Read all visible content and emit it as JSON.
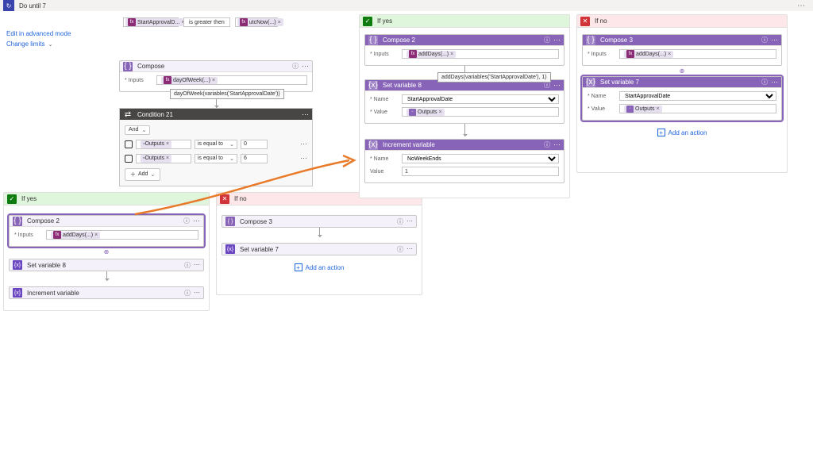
{
  "topbar": {
    "title": "Do until 7"
  },
  "links": {
    "advanced": "Edit in advanced mode",
    "limits": "Change limits"
  },
  "tokenrow": {
    "tok1": "StartApprovalD...",
    "op": "is greater then",
    "tok2": "utcNow(...)"
  },
  "compose": {
    "title": "Compose",
    "inputs_label": "* Inputs",
    "token": "dayOfWeek(...)",
    "tooltip": "dayOfWeek(variables('StartApprovalDate'))"
  },
  "cond": {
    "title": "Condition 21",
    "and": "And",
    "rows": [
      {
        "left": "Outputs",
        "op": "is equal to",
        "val": "0"
      },
      {
        "left": "Outputs",
        "op": "is equal to",
        "val": "6"
      }
    ],
    "add": "Add"
  },
  "branchLeft": {
    "yes": "If yes",
    "no": "If no",
    "compose2": "Compose 2",
    "compose3": "Compose 3",
    "setvar8": "Set variable 8",
    "setvar7": "Set variable 7",
    "incr": "Increment variable",
    "inputs_label": "* Inputs",
    "addDays": "addDays(...)",
    "addaction": "Add an action"
  },
  "right": {
    "yes": "If yes",
    "no": "If no",
    "compose2": {
      "title": "Compose 2",
      "inputs_label": "* Inputs",
      "token": "addDays(...)",
      "tooltip": "addDays(variables('StartApprovalDate'), 1)"
    },
    "compose3": {
      "title": "Compose 3",
      "inputs_label": "* Inputs",
      "token": "addDays(...)"
    },
    "setvar8": {
      "title": "Set variable 8",
      "name_label": "* Name",
      "name_val": "StartApprovalDate",
      "value_label": "* Value",
      "outputs": "Outputs"
    },
    "setvar7": {
      "title": "Set variable 7",
      "name_label": "* Name",
      "name_val": "StartApprovalDate",
      "value_label": "* Value",
      "outputs": "Outputs"
    },
    "incr": {
      "title": "Increment variable",
      "name_label": "* Name",
      "name_val": "NoWeekEnds",
      "value_label": "Value",
      "val": "1"
    },
    "addaction": "Add an action"
  }
}
